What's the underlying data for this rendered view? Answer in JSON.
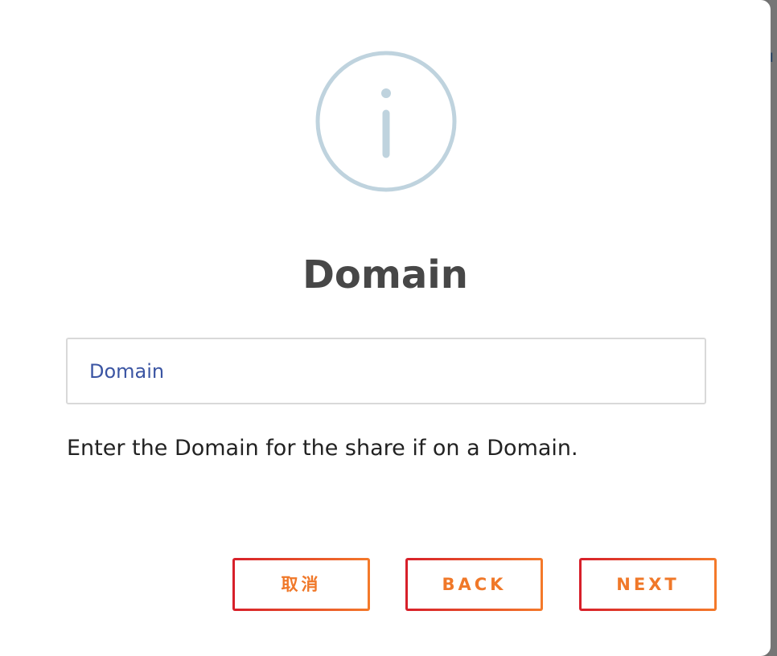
{
  "dialog": {
    "title": "Domain",
    "icon": "info-circle-icon",
    "icon_color": "#bfd3de",
    "input": {
      "placeholder": "Domain",
      "value": ""
    },
    "helper_text": "Enter the Domain for the share if on a Domain.",
    "buttons": {
      "cancel_label": "取消",
      "back_label": "BACK",
      "next_label": "NEXT"
    },
    "accent_colors": {
      "button_gradient_start": "#d71f2a",
      "button_gradient_end": "#f47a2a",
      "button_text": "#f07829",
      "input_text": "#3b55a3"
    }
  }
}
